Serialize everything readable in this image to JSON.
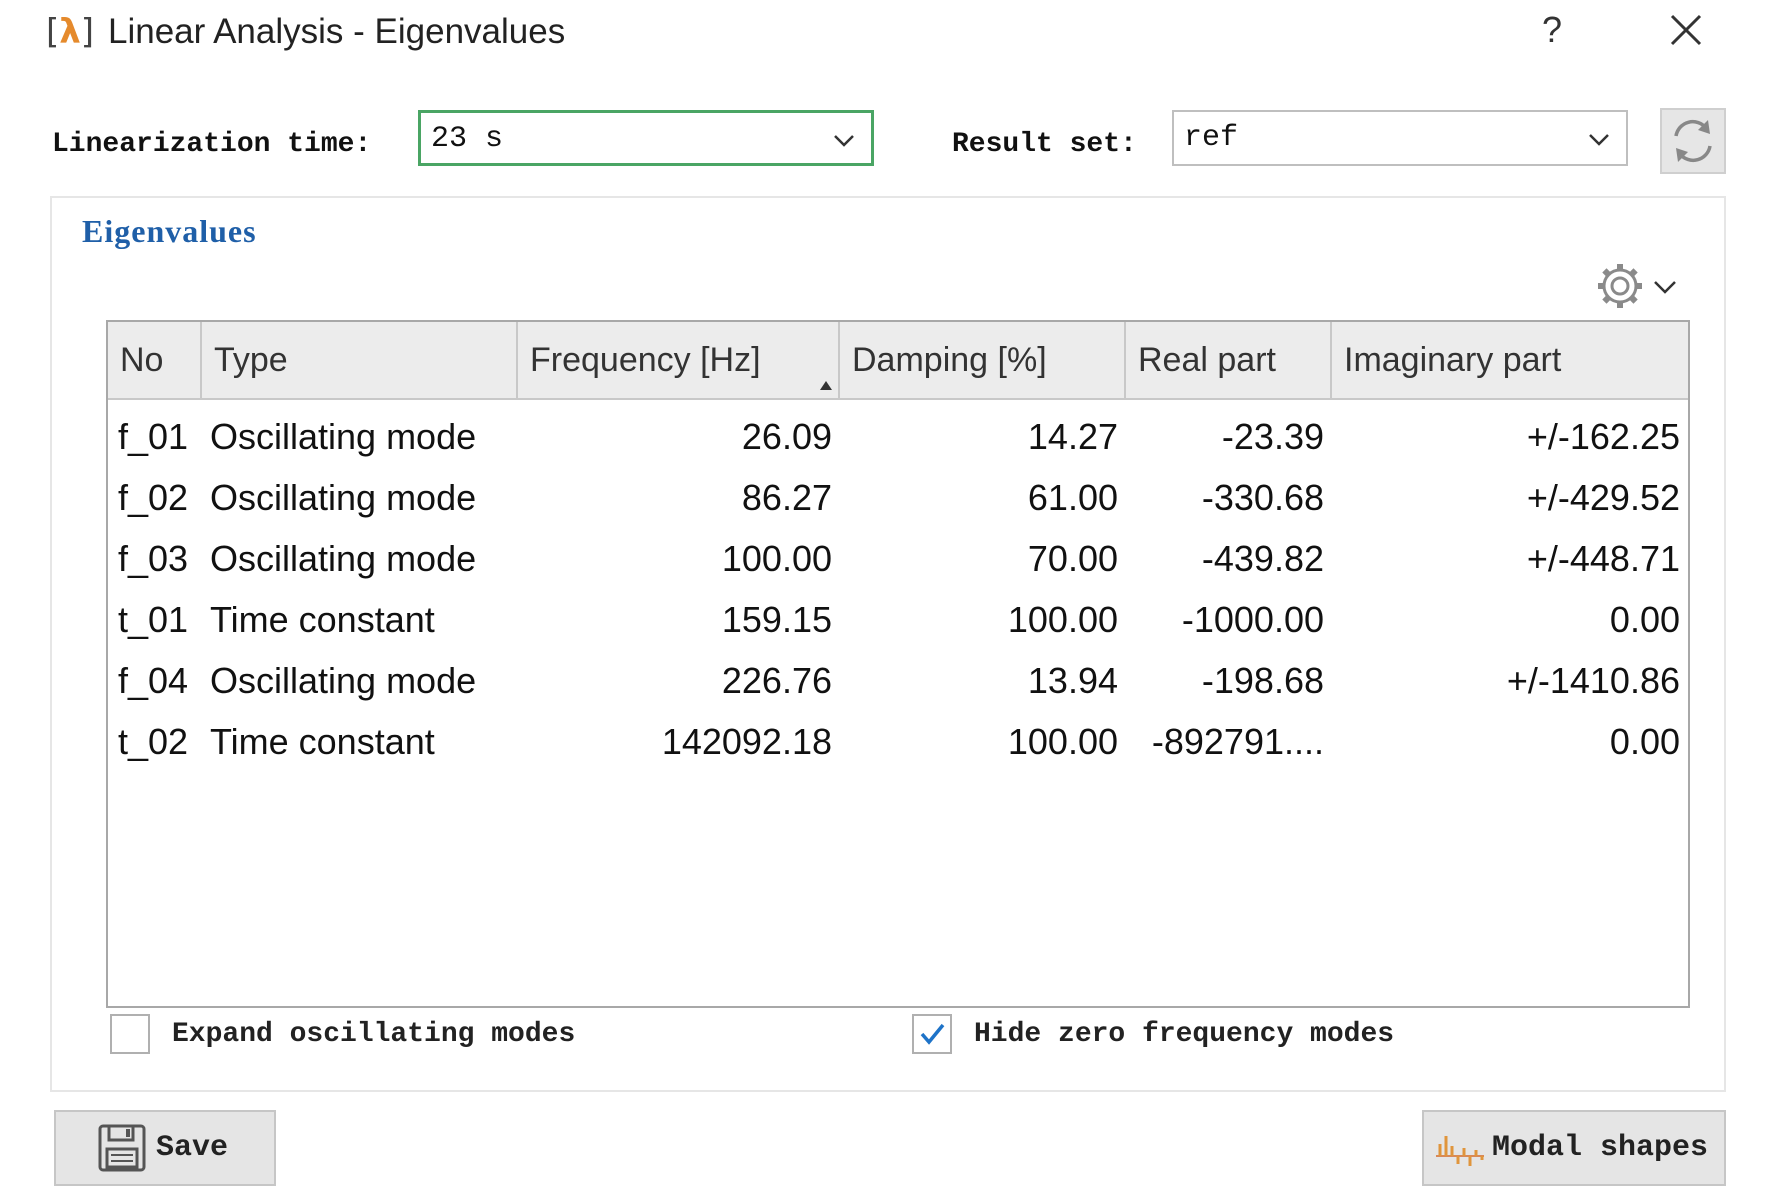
{
  "window": {
    "title": "Linear Analysis - Eigenvalues",
    "help_label": "?"
  },
  "controls": {
    "linearization_label": "Linearization time:",
    "linearization_value": "23 s",
    "result_set_label": "Result set:",
    "result_set_value": "ref"
  },
  "group": {
    "title": "Eigenvalues"
  },
  "table": {
    "columns": [
      "No",
      "Type",
      "Frequency [Hz]",
      "Damping [%]",
      "Real part",
      "Imaginary part"
    ],
    "sorted_column": "Frequency [Hz]",
    "rows": [
      {
        "no": "f_01",
        "type": "Oscillating mode",
        "frequency": "26.09",
        "damping": "14.27",
        "real": "-23.39",
        "imag": "+/-162.25"
      },
      {
        "no": "f_02",
        "type": "Oscillating mode",
        "frequency": "86.27",
        "damping": "61.00",
        "real": "-330.68",
        "imag": "+/-429.52"
      },
      {
        "no": "f_03",
        "type": "Oscillating mode",
        "frequency": "100.00",
        "damping": "70.00",
        "real": "-439.82",
        "imag": "+/-448.71"
      },
      {
        "no": "t_01",
        "type": "Time constant",
        "frequency": "159.15",
        "damping": "100.00",
        "real": "-1000.00",
        "imag": "0.00"
      },
      {
        "no": "f_04",
        "type": "Oscillating mode",
        "frequency": "226.76",
        "damping": "13.94",
        "real": "-198.68",
        "imag": "+/-1410.86"
      },
      {
        "no": "t_02",
        "type": "Time constant",
        "frequency": "142092.18",
        "damping": "100.00",
        "real": "-892791....",
        "imag": "0.00"
      }
    ]
  },
  "options": {
    "expand_label": "Expand oscillating modes",
    "expand_checked": false,
    "hide_zero_label": "Hide zero frequency modes",
    "hide_zero_checked": true
  },
  "buttons": {
    "save_label": "Save",
    "modal_shapes_label": "Modal shapes"
  },
  "colors": {
    "accent_focus": "#4aa564",
    "group_title": "#1f5fa8",
    "check": "#1e73c8",
    "app_icon": "#e58a2c"
  }
}
